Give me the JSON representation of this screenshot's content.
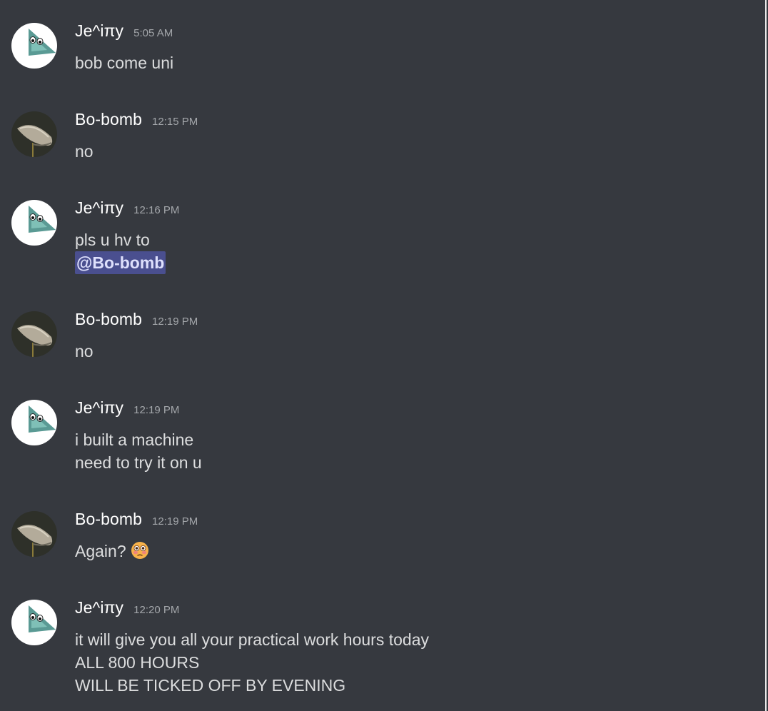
{
  "users": {
    "jeity": {
      "name": "Je^iπy",
      "avatar_icon": "green-fish-avatar-icon"
    },
    "bobomb": {
      "name": "Bo-bomb",
      "avatar_icon": "whale-fish-avatar-icon"
    }
  },
  "messages": [
    {
      "author": "Je^iπy",
      "time": "5:05 AM",
      "lines": [
        "bob come uni"
      ]
    },
    {
      "author": "Bo-bomb",
      "time": "12:15 PM",
      "lines": [
        "no"
      ]
    },
    {
      "author": "Je^iπy",
      "time": "12:16 PM",
      "lines": [
        "pls u hv to"
      ],
      "mention": "@Bo-bomb"
    },
    {
      "author": "Bo-bomb",
      "time": "12:19 PM",
      "lines": [
        "no"
      ]
    },
    {
      "author": "Je^iπy",
      "time": "12:19 PM",
      "lines": [
        "i built a machine",
        "need to try it on u"
      ]
    },
    {
      "author": "Bo-bomb",
      "time": "12:19 PM",
      "lines": [
        "Again?"
      ],
      "emoji": "flushed-face-emoji"
    },
    {
      "author": "Je^iπy",
      "time": "12:20 PM",
      "lines": [
        "it will give you all your practical work hours today",
        "ALL 800 HOURS",
        "WILL BE TICKED OFF BY EVENING"
      ]
    }
  ],
  "colors": {
    "background": "#36393f",
    "username": "#ffffff",
    "text": "#dcddde",
    "timestamp": "#a3a6aa",
    "mention_bg": "#4a4f8f",
    "mention_text": "#dee0fc"
  }
}
